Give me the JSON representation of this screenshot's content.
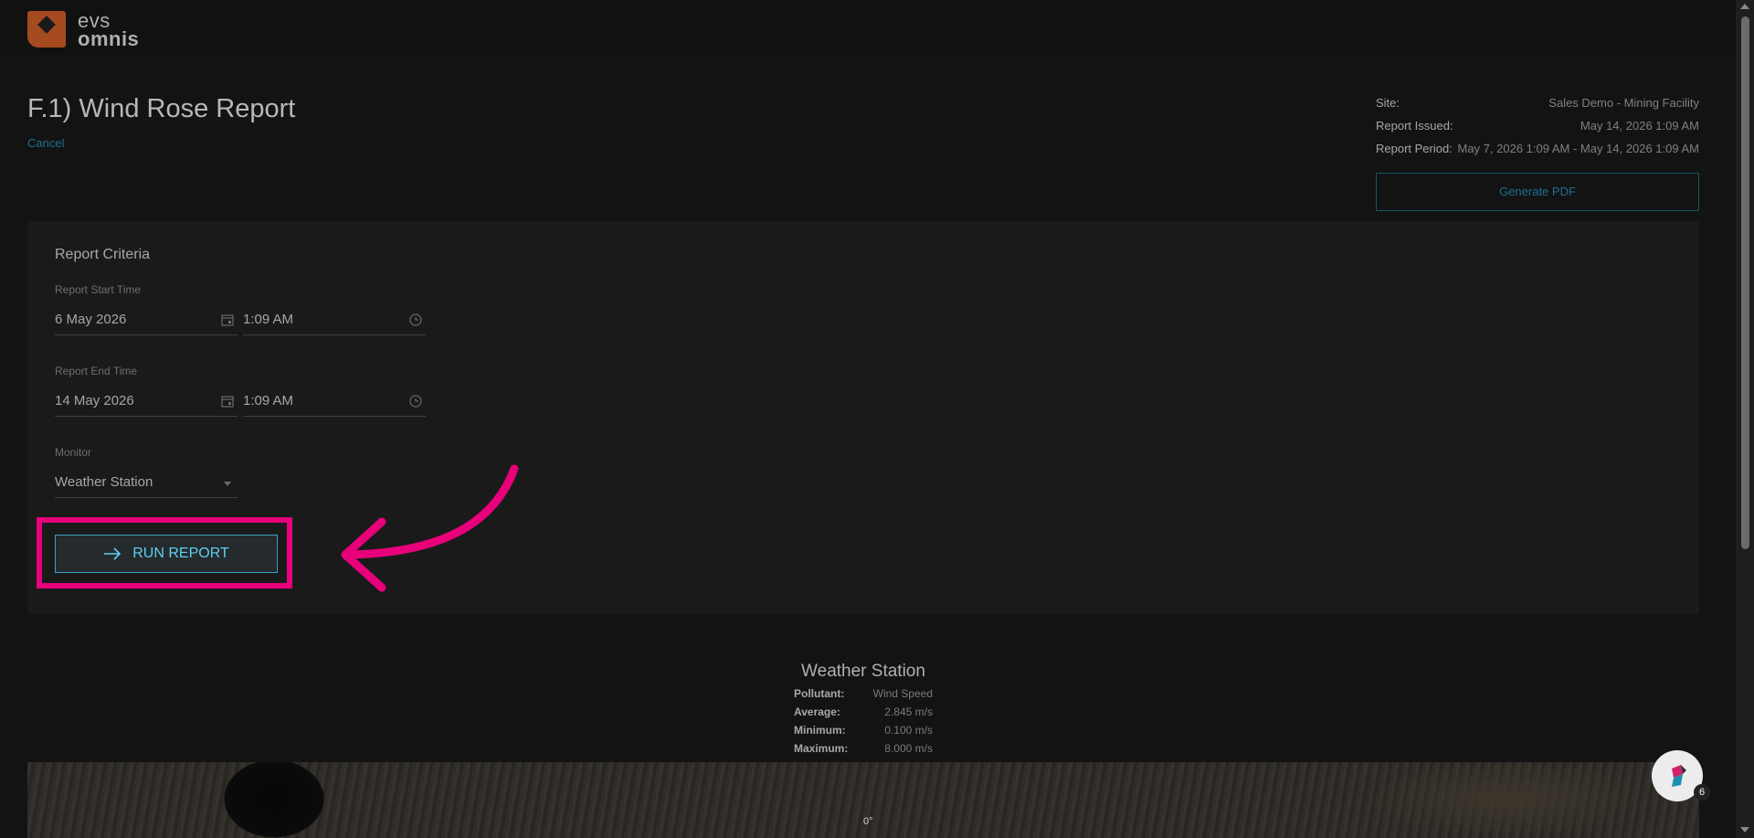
{
  "brand": {
    "line1": "evs",
    "line2": "omnis"
  },
  "page": {
    "title": "F.1) Wind Rose Report",
    "cancel": "Cancel"
  },
  "meta": {
    "site_label": "Site:",
    "site_value": "Sales Demo - Mining Facility",
    "issued_label": "Report Issued:",
    "issued_value": "May 14, 2026 1:09 AM",
    "period_label": "Report Period:",
    "period_value": "May 7, 2026 1:09 AM - May 14, 2026 1:09 AM"
  },
  "pdf_button": "Generate PDF",
  "criteria": {
    "title": "Report Criteria",
    "start_label": "Report Start Time",
    "start_date": "6 May 2026",
    "start_time": "1:09 AM",
    "end_label": "Report End Time",
    "end_date": "14 May 2026",
    "end_time": "1:09 AM",
    "monitor_label": "Monitor",
    "monitor_value": "Weather Station",
    "run_button": "RUN REPORT"
  },
  "result": {
    "title": "Weather Station",
    "stats": [
      {
        "k": "Pollutant:",
        "v": "Wind Speed"
      },
      {
        "k": "Average:",
        "v": "2.845 m/s"
      },
      {
        "k": "Minimum:",
        "v": "0.100 m/s"
      },
      {
        "k": "Maximum:",
        "v": "8.000 m/s"
      }
    ],
    "map_direction_label": "0°"
  },
  "helper": {
    "badge": "6"
  },
  "colors": {
    "accent": "#e8007a",
    "link": "#1f6f8b",
    "button_text": "#5fd0f0",
    "brand": "#a64b1f"
  }
}
